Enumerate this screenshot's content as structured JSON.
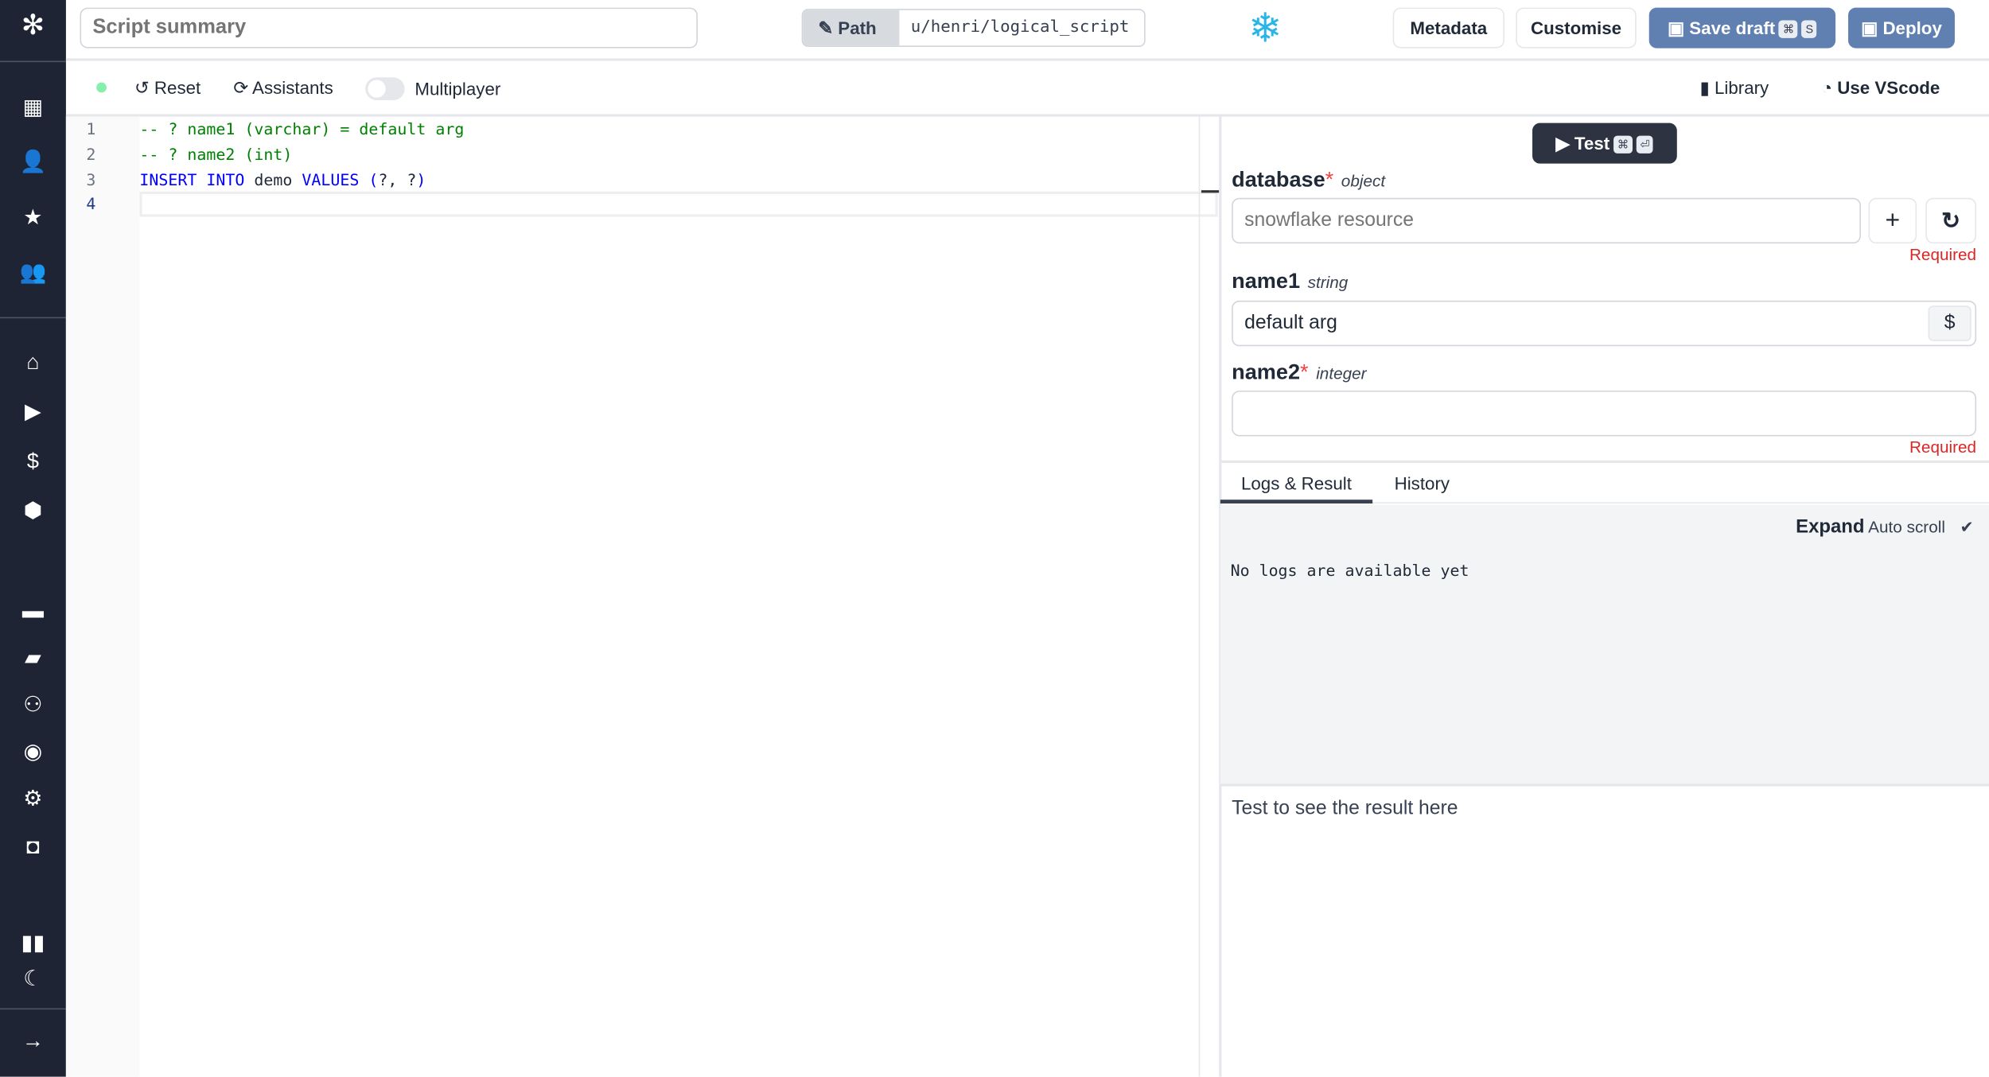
{
  "sidebar": {
    "top_icons": [
      "windmill-logo-icon"
    ],
    "items": [
      {
        "name": "building-icon",
        "glyph": "▦"
      },
      {
        "name": "user-icon",
        "glyph": "👤"
      },
      {
        "name": "star-icon",
        "glyph": "★"
      },
      {
        "name": "users-icon",
        "glyph": "👥"
      },
      {
        "name": "home-icon",
        "glyph": "⌂"
      },
      {
        "name": "play-icon",
        "glyph": "▶"
      },
      {
        "name": "dollar-icon",
        "glyph": "$"
      },
      {
        "name": "cubes-icon",
        "glyph": "⬢"
      },
      {
        "name": "calendar-icon",
        "glyph": "▬"
      },
      {
        "name": "folder-open-icon",
        "glyph": "▰"
      },
      {
        "name": "users-cog-icon",
        "glyph": "⚇"
      },
      {
        "name": "eye-icon",
        "glyph": "◉"
      },
      {
        "name": "settings-icon",
        "glyph": "⚙"
      },
      {
        "name": "bot-icon",
        "glyph": "◘"
      },
      {
        "name": "book-open-icon",
        "glyph": "▮▮"
      },
      {
        "name": "moon-icon",
        "glyph": "☾"
      },
      {
        "name": "arrow-right-icon",
        "glyph": "→"
      }
    ]
  },
  "header": {
    "summary_placeholder": "Script summary",
    "path_label": "Path",
    "path_value": "u/henri/logical_script",
    "metadata": "Metadata",
    "customise": "Customise",
    "save_draft": "Save draft",
    "save_kbd1": "⌘",
    "save_kbd2": "S",
    "deploy": "Deploy",
    "brand_color": "#29b5e8",
    "accent": "#5f80b0"
  },
  "toolbar": {
    "reset": "Reset",
    "assistants": "Assistants",
    "multiplayer": "Multiplayer",
    "multiplayer_on": false,
    "library": "Library",
    "vscode": "Use VScode"
  },
  "editor": {
    "line_numbers": [
      "1",
      "2",
      "3",
      "4"
    ],
    "lines": [
      [
        {
          "t": "-- ? name1 (varchar) = default arg",
          "c": "cm"
        }
      ],
      [
        {
          "t": "-- ? name2 (int)",
          "c": "cm"
        }
      ],
      [
        {
          "t": "INSERT INTO",
          "c": "kw"
        },
        {
          "t": " demo ",
          "c": ""
        },
        {
          "t": "VALUES",
          "c": "kw"
        },
        {
          "t": " (",
          "c": "kw"
        },
        {
          "t": "?, ?",
          "c": ""
        },
        {
          "t": ")",
          "c": "kw"
        }
      ],
      []
    ]
  },
  "test": {
    "label": "Test",
    "kbd1": "⌘",
    "kbd2": "⏎"
  },
  "form": {
    "database": {
      "name": "database",
      "type": "object",
      "placeholder": "snowflake resource",
      "required": "Required"
    },
    "name1": {
      "name": "name1",
      "type": "string",
      "value": "default arg",
      "dollar": "$"
    },
    "name2": {
      "name": "name2",
      "type": "integer",
      "value": "",
      "required": "Required"
    },
    "asterisk": "*"
  },
  "logs": {
    "tabs": [
      "Logs & Result",
      "History"
    ],
    "expand": "Expand",
    "autoscroll": "Auto scroll",
    "check": "✔",
    "empty": "No logs are available yet",
    "result_placeholder": "Test to see the result here"
  }
}
